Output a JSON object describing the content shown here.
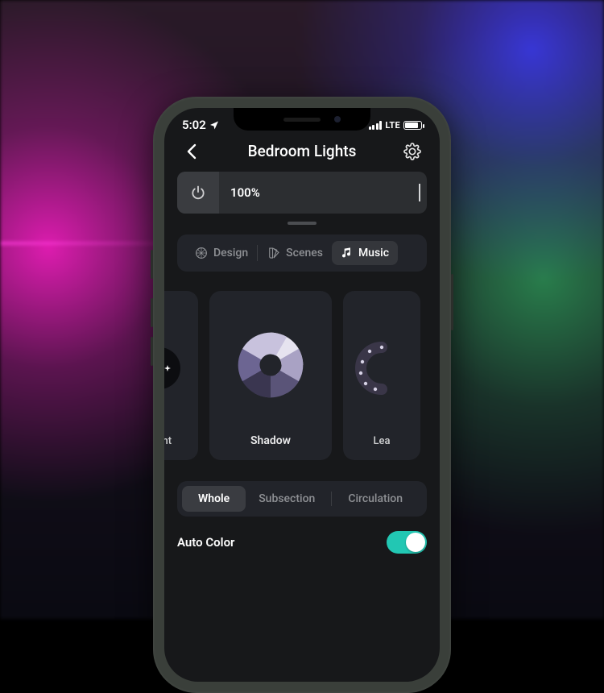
{
  "status": {
    "time": "5:02",
    "location_icon": "location-arrow",
    "carrier_label": "LTE"
  },
  "header": {
    "title": "Bedroom Lights"
  },
  "brightness": {
    "percent_label": "100%"
  },
  "segments": {
    "design": "Design",
    "scenes": "Scenes",
    "music": "Music",
    "active": "music"
  },
  "effects": {
    "left_label": "rlight",
    "center_label": "Shadow",
    "right_label": "Lea"
  },
  "modes": {
    "whole": "Whole",
    "subsection": "Subsection",
    "circulation": "Circulation",
    "active": "whole"
  },
  "auto_color": {
    "label": "Auto Color",
    "on": true
  },
  "colors": {
    "accent": "#22c7b3",
    "card": "#22242a",
    "screen": "#17181a"
  }
}
